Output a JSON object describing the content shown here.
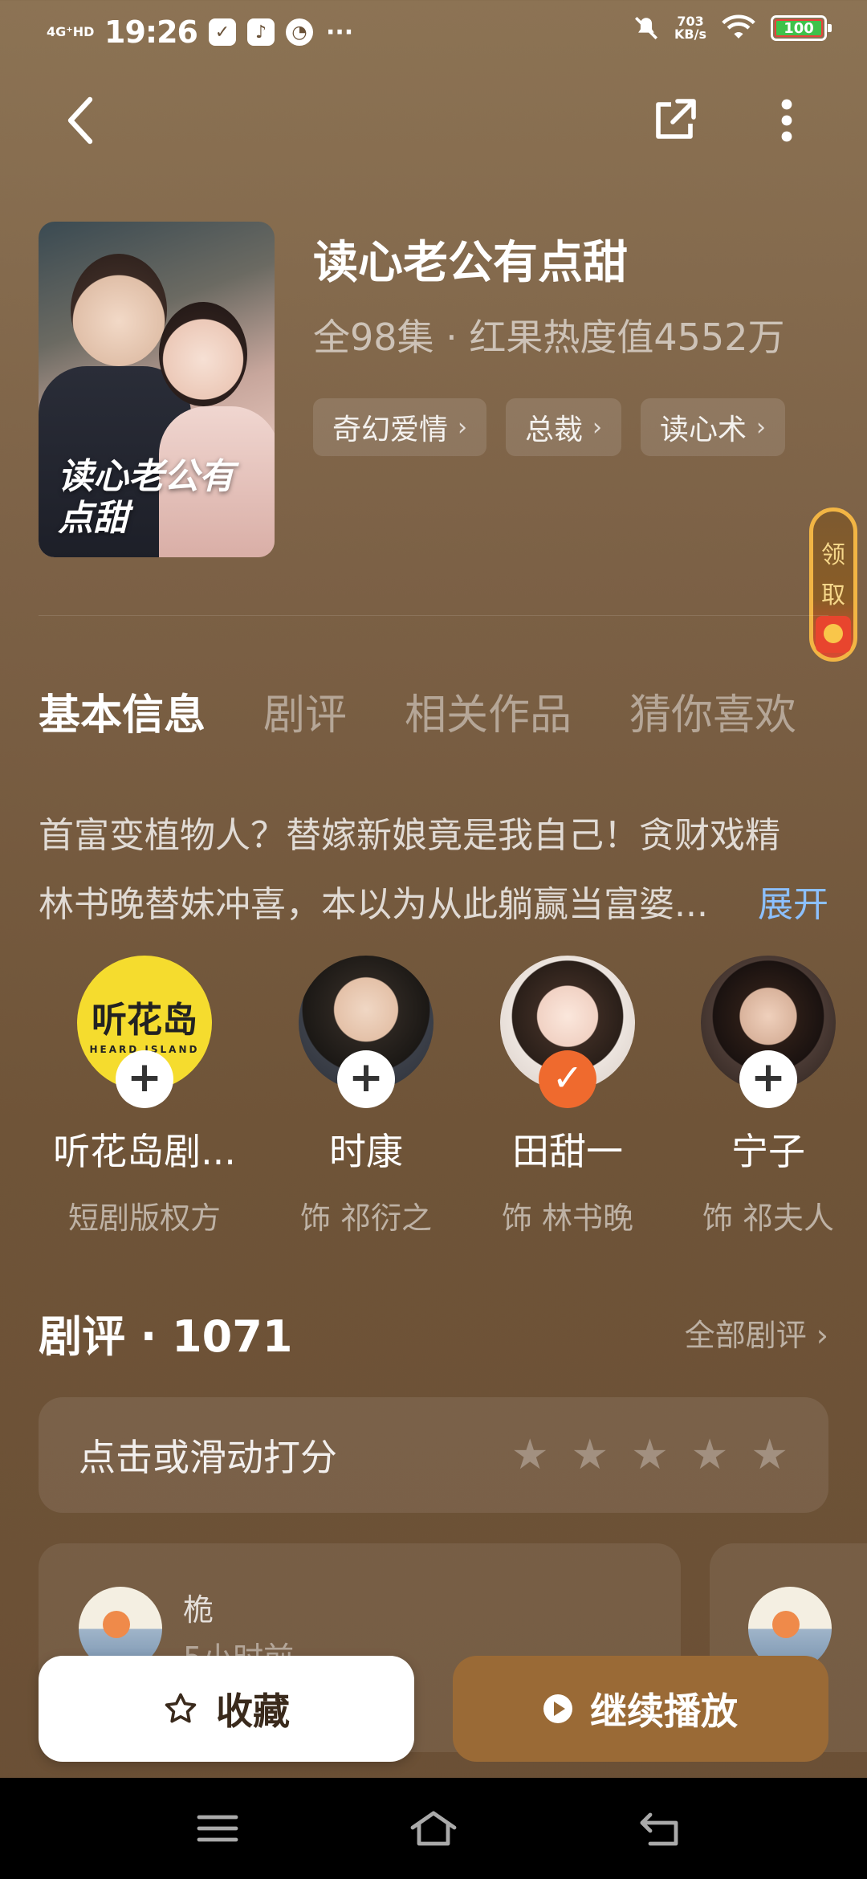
{
  "status_bar": {
    "signal": "4G⁺HD",
    "time": "19:26",
    "net_speed": "703",
    "net_unit": "KB/s",
    "battery": "100",
    "more": "···"
  },
  "drama": {
    "title": "读心老公有点甜",
    "poster_title": "读心老公有点甜",
    "meta": "全98集 · 红果热度值4552万",
    "tags": [
      "奇幻爱情",
      "总裁",
      "读心术"
    ]
  },
  "claim": {
    "label_1": "领",
    "label_2": "取"
  },
  "tabs": [
    "基本信息",
    "剧评",
    "相关作品",
    "猜你喜欢"
  ],
  "description": {
    "line1": "首富变植物人？替嫁新娘竟是我自己！贪财戏精",
    "line2": "林书晚替妹冲喜，本以为从此躺赢当富婆...",
    "expand": "展开"
  },
  "cast": [
    {
      "name": "听花岛剧...",
      "role": "短剧版权方",
      "followed": false,
      "logo_text": "听花岛",
      "logo_sub": "HEARD ISLAND"
    },
    {
      "name": "时康",
      "role": "饰 祁衍之",
      "followed": false
    },
    {
      "name": "田甜一",
      "role": "饰 林书晚",
      "followed": true
    },
    {
      "name": "宁子",
      "role": "饰 祁夫人",
      "followed": false
    }
  ],
  "reviews": {
    "title": "剧评 · 1071",
    "all": "全部剧评 ›",
    "rate_label": "点击或滑动打分",
    "star_count": 5,
    "first": {
      "user": "桅",
      "time": "5小时前"
    }
  },
  "actions": {
    "collect": "收藏",
    "play": "继续播放"
  },
  "icons": {
    "back": "back-arrow-icon",
    "share": "share-icon",
    "more": "more-vertical-icon",
    "star": "star-icon",
    "play": "play-icon",
    "add": "plus-icon",
    "check": "check-icon"
  },
  "colors": {
    "accent": "#9a6a36",
    "follow_badge": "#ef6a2e",
    "expand": "#8cc0ff"
  }
}
